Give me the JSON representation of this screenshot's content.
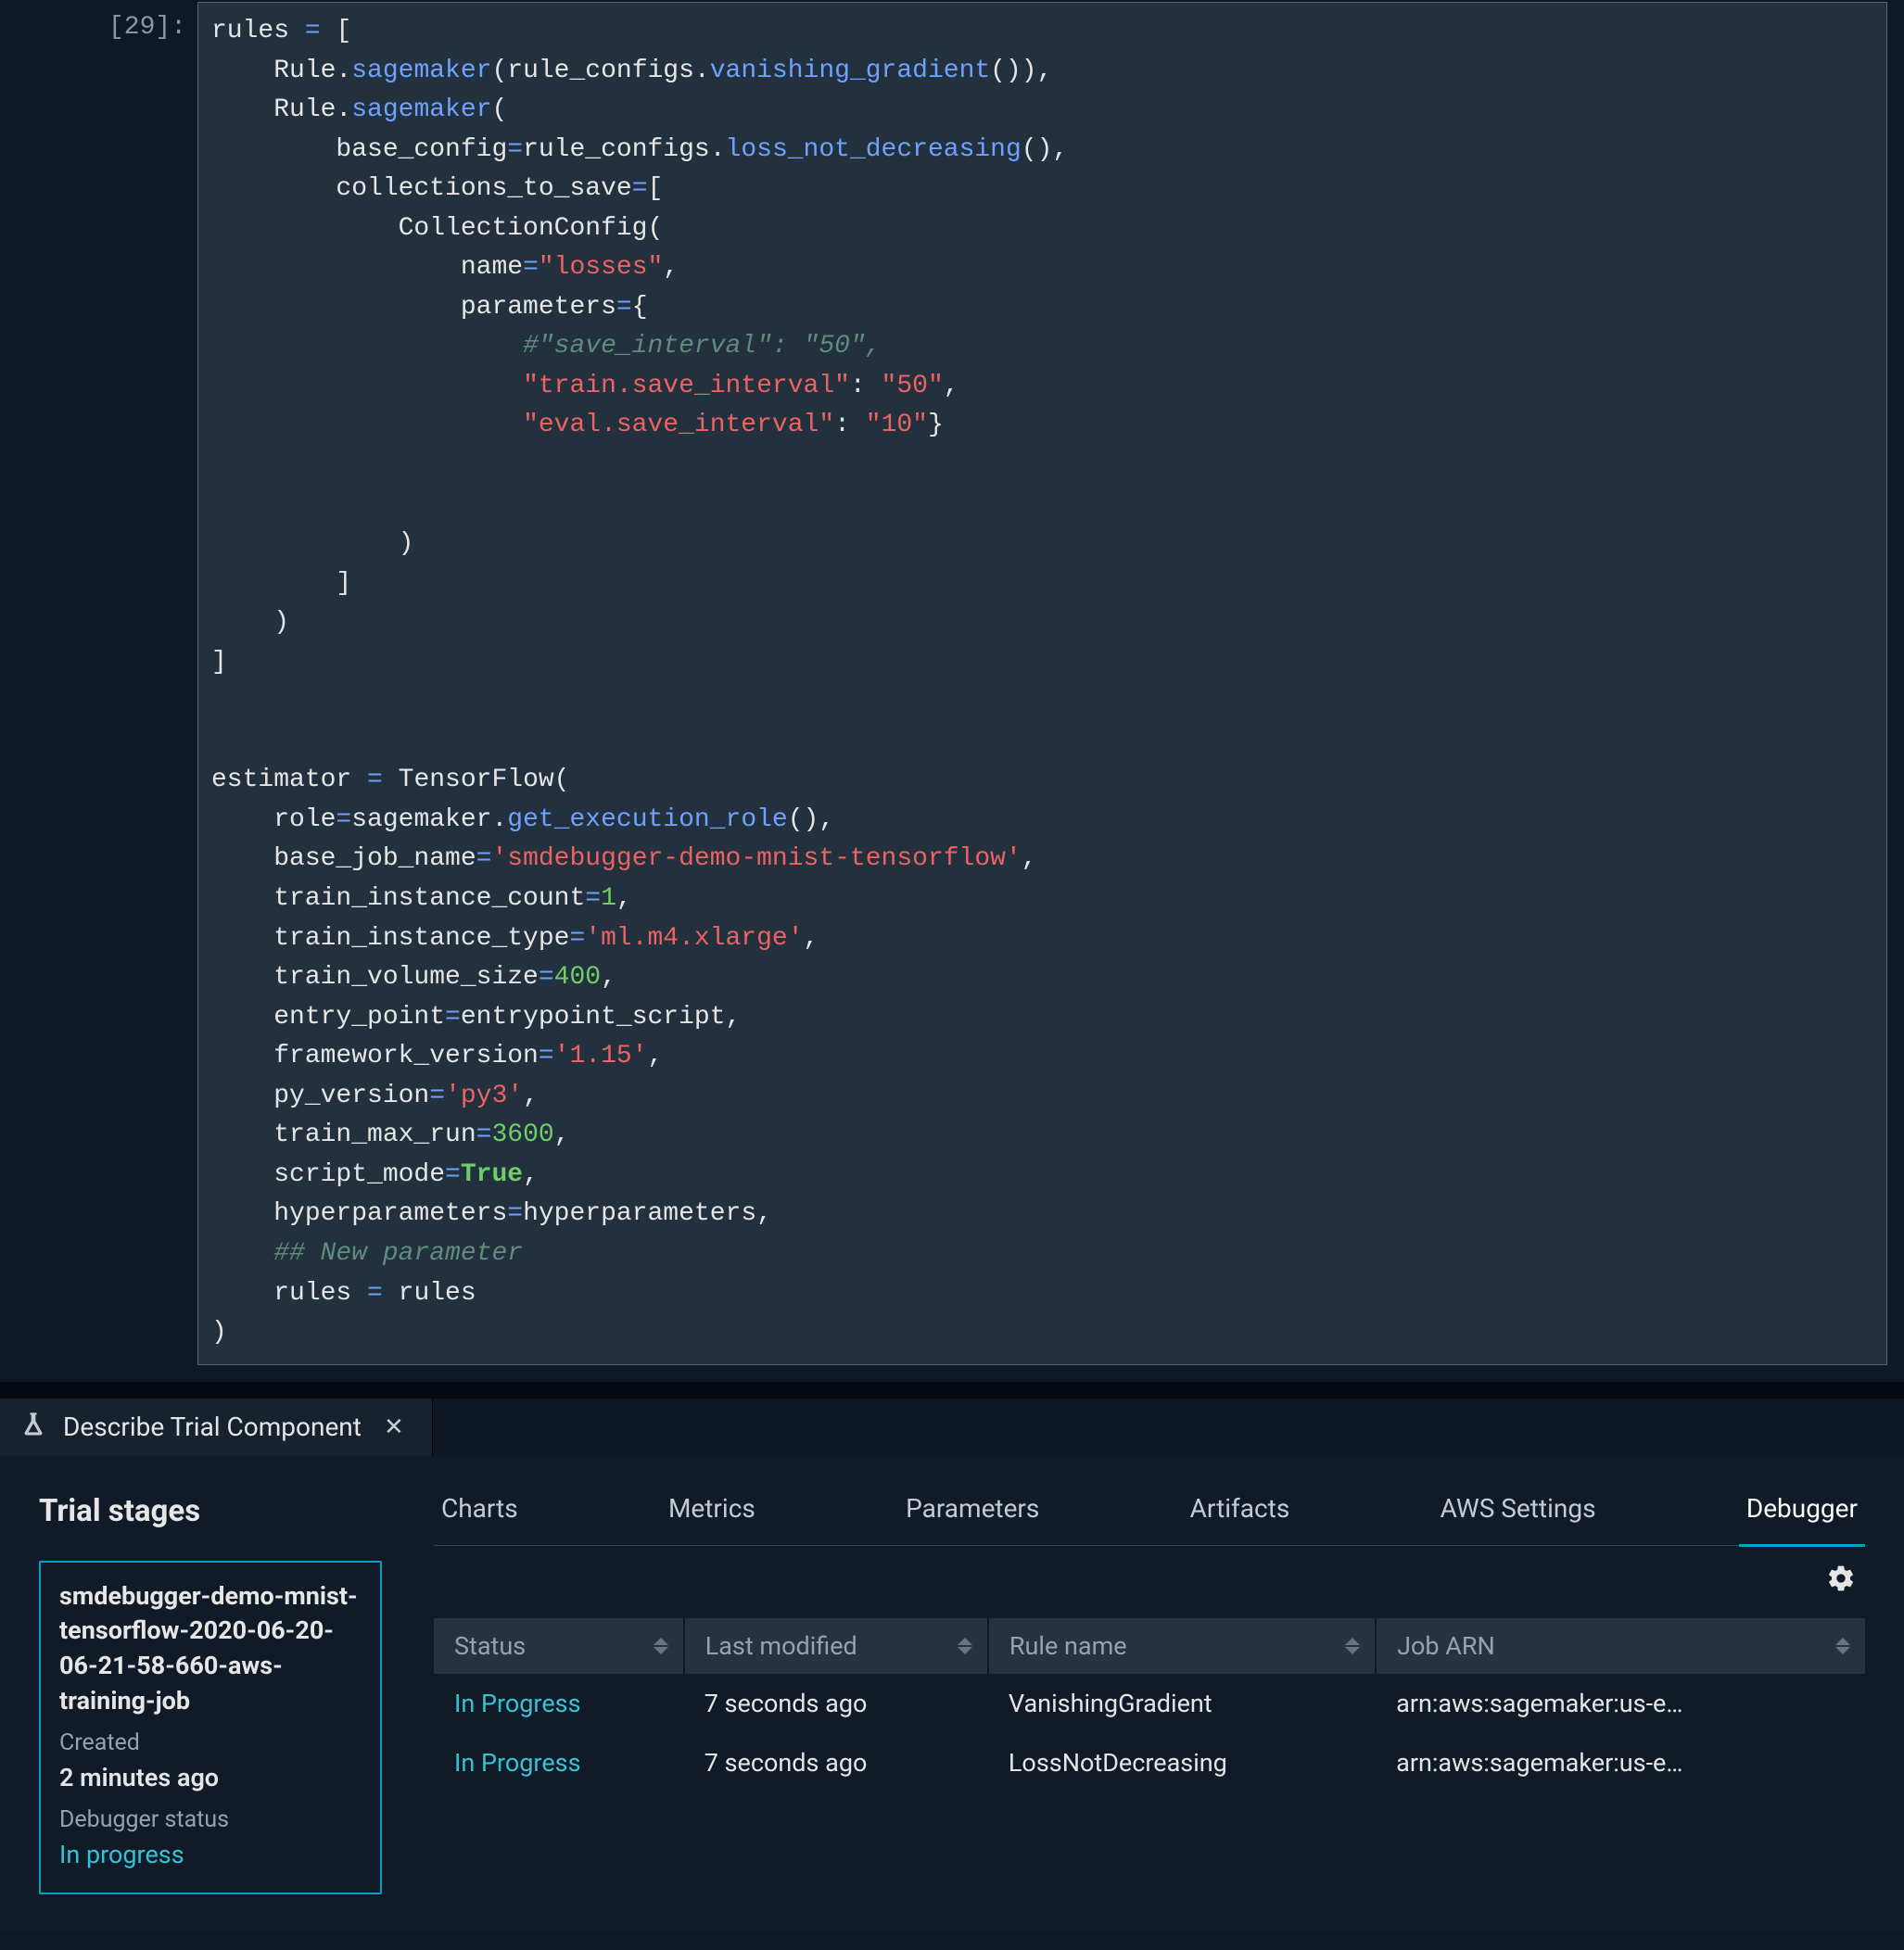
{
  "cell": {
    "prompt": "[29]:",
    "code_tokens": [
      [
        {
          "t": "rules "
        },
        {
          "t": "=",
          "c": "op"
        },
        {
          "t": " ["
        }
      ],
      [
        {
          "t": "    Rule"
        },
        {
          "t": ".",
          "c": ""
        },
        {
          "t": "sagemaker",
          "c": "fn"
        },
        {
          "t": "(rule_configs"
        },
        {
          "t": ".",
          "c": ""
        },
        {
          "t": "vanishing_gradient",
          "c": "fn"
        },
        {
          "t": "()),"
        }
      ],
      [
        {
          "t": "    Rule"
        },
        {
          "t": ".",
          "c": ""
        },
        {
          "t": "sagemaker",
          "c": "fn"
        },
        {
          "t": "("
        }
      ],
      [
        {
          "t": "        base_config"
        },
        {
          "t": "=",
          "c": "op"
        },
        {
          "t": "rule_configs"
        },
        {
          "t": ".",
          "c": ""
        },
        {
          "t": "loss_not_decreasing",
          "c": "fn"
        },
        {
          "t": "(),"
        }
      ],
      [
        {
          "t": "        collections_to_save"
        },
        {
          "t": "=",
          "c": "op"
        },
        {
          "t": "["
        }
      ],
      [
        {
          "t": "            CollectionConfig("
        }
      ],
      [
        {
          "t": "                name"
        },
        {
          "t": "=",
          "c": "op"
        },
        {
          "t": "\"losses\"",
          "c": "str"
        },
        {
          "t": ","
        }
      ],
      [
        {
          "t": "                parameters"
        },
        {
          "t": "=",
          "c": "op"
        },
        {
          "t": "{"
        }
      ],
      [
        {
          "t": "                    "
        },
        {
          "t": "#\"save_interval\": \"50\",",
          "c": "cm"
        }
      ],
      [
        {
          "t": "                    "
        },
        {
          "t": "\"train.save_interval\"",
          "c": "str"
        },
        {
          "t": ": "
        },
        {
          "t": "\"50\"",
          "c": "str"
        },
        {
          "t": ","
        }
      ],
      [
        {
          "t": "                    "
        },
        {
          "t": "\"eval.save_interval\"",
          "c": "str"
        },
        {
          "t": ": "
        },
        {
          "t": "\"10\"",
          "c": "str"
        },
        {
          "t": "}"
        }
      ],
      [
        {
          "t": ""
        }
      ],
      [
        {
          "t": ""
        }
      ],
      [
        {
          "t": "            )"
        }
      ],
      [
        {
          "t": "        ]"
        }
      ],
      [
        {
          "t": "    )"
        }
      ],
      [
        {
          "t": "]"
        }
      ],
      [
        {
          "t": ""
        }
      ],
      [
        {
          "t": ""
        }
      ],
      [
        {
          "t": "estimator "
        },
        {
          "t": "=",
          "c": "op"
        },
        {
          "t": " TensorFlow("
        }
      ],
      [
        {
          "t": "    role"
        },
        {
          "t": "=",
          "c": "op"
        },
        {
          "t": "sagemaker"
        },
        {
          "t": ".",
          "c": ""
        },
        {
          "t": "get_execution_role",
          "c": "fn"
        },
        {
          "t": "(),"
        }
      ],
      [
        {
          "t": "    base_job_name"
        },
        {
          "t": "=",
          "c": "op"
        },
        {
          "t": "'smdebugger-demo-mnist-tensorflow'",
          "c": "str"
        },
        {
          "t": ","
        }
      ],
      [
        {
          "t": "    train_instance_count"
        },
        {
          "t": "=",
          "c": "op"
        },
        {
          "t": "1",
          "c": "num"
        },
        {
          "t": ","
        }
      ],
      [
        {
          "t": "    train_instance_type"
        },
        {
          "t": "=",
          "c": "op"
        },
        {
          "t": "'ml.m4.xlarge'",
          "c": "str"
        },
        {
          "t": ","
        }
      ],
      [
        {
          "t": "    train_volume_size"
        },
        {
          "t": "=",
          "c": "op"
        },
        {
          "t": "400",
          "c": "num"
        },
        {
          "t": ","
        }
      ],
      [
        {
          "t": "    entry_point"
        },
        {
          "t": "=",
          "c": "op"
        },
        {
          "t": "entrypoint_script,"
        }
      ],
      [
        {
          "t": "    framework_version"
        },
        {
          "t": "=",
          "c": "op"
        },
        {
          "t": "'1.15'",
          "c": "str"
        },
        {
          "t": ","
        }
      ],
      [
        {
          "t": "    py_version"
        },
        {
          "t": "=",
          "c": "op"
        },
        {
          "t": "'py3'",
          "c": "str"
        },
        {
          "t": ","
        }
      ],
      [
        {
          "t": "    train_max_run"
        },
        {
          "t": "=",
          "c": "op"
        },
        {
          "t": "3600",
          "c": "num"
        },
        {
          "t": ","
        }
      ],
      [
        {
          "t": "    script_mode"
        },
        {
          "t": "=",
          "c": "op"
        },
        {
          "t": "True",
          "c": "bool"
        },
        {
          "t": ","
        }
      ],
      [
        {
          "t": "    hyperparameters"
        },
        {
          "t": "=",
          "c": "op"
        },
        {
          "t": "hyperparameters,"
        }
      ],
      [
        {
          "t": "    "
        },
        {
          "t": "## New parameter",
          "c": "cm"
        }
      ],
      [
        {
          "t": "    rules "
        },
        {
          "t": "=",
          "c": "op"
        },
        {
          "t": " rules"
        }
      ],
      [
        {
          "t": ")"
        }
      ]
    ]
  },
  "tab": {
    "title": "Describe Trial Component"
  },
  "sidebar": {
    "heading": "Trial stages",
    "stage": {
      "title": "smdebugger-demo-mnist-tensorflow-2020-06-20-06-21-58-660-aws-training-job",
      "created_label": "Created",
      "created_value": "2 minutes ago",
      "debug_label": "Debugger status",
      "debug_value": "In progress"
    }
  },
  "tabnav": {
    "items": [
      "Charts",
      "Metrics",
      "Parameters",
      "Artifacts",
      "AWS Settings",
      "Debugger"
    ],
    "active": 5
  },
  "table": {
    "headers": [
      "Status",
      "Last modified",
      "Rule name",
      "Job ARN"
    ],
    "rows": [
      {
        "status": "In Progress",
        "modified": "7 seconds ago",
        "rule": "VanishingGradient",
        "arn": "arn:aws:sagemaker:us-e…"
      },
      {
        "status": "In Progress",
        "modified": "7 seconds ago",
        "rule": "LossNotDecreasing",
        "arn": "arn:aws:sagemaker:us-e…"
      }
    ]
  }
}
